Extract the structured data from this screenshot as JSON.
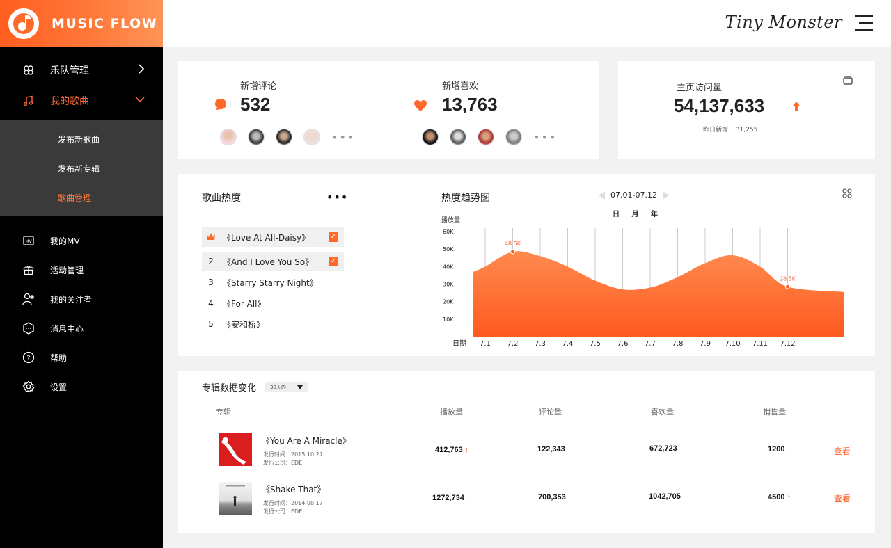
{
  "sidebar": {
    "brand": "MUSIC FLOW",
    "items": [
      {
        "label": "乐队管理",
        "icon": "band-icon"
      },
      {
        "label": "我的歌曲",
        "icon": "music-note-icon"
      }
    ],
    "subitems": [
      {
        "label": "发布新歌曲"
      },
      {
        "label": "发布新专辑"
      },
      {
        "label": "歌曲管理"
      }
    ],
    "lower_items": [
      {
        "label": "我的MV",
        "icon": "mv-icon"
      },
      {
        "label": "活动管理",
        "icon": "gift-icon"
      },
      {
        "label": "我的关注者",
        "icon": "user-add-icon"
      },
      {
        "label": "消息中心",
        "icon": "message-icon"
      },
      {
        "label": "帮助",
        "icon": "help-icon"
      },
      {
        "label": "设置",
        "icon": "gear-icon"
      }
    ]
  },
  "topbar": {
    "script_brand": "Tiny Monster"
  },
  "stats": {
    "comments": {
      "label": "新增评论",
      "value": "532"
    },
    "likes": {
      "label": "新增喜欢",
      "value": "13,763"
    },
    "visits": {
      "label": "主页访问量",
      "value": "54,137,633",
      "sub_label": "昨日新增",
      "sub_value": "31,255"
    }
  },
  "popularity": {
    "title": "歌曲热度",
    "songs": [
      {
        "rank": "",
        "title": "《Love At All-Daisy》"
      },
      {
        "rank": "2",
        "title": "《And I Love You So》"
      },
      {
        "rank": "3",
        "title": "《Starry Starry Night》"
      },
      {
        "rank": "4",
        "title": "《For All》"
      },
      {
        "rank": "5",
        "title": "《安和桥》"
      }
    ]
  },
  "trend": {
    "title": "热度趋势图",
    "range": "07.01-07.12",
    "periods": [
      "日",
      "月",
      "年"
    ]
  },
  "chart_data": {
    "type": "area",
    "ylabel": "播放量",
    "xlabel": "日期",
    "yticks": [
      "10K",
      "20K",
      "30K",
      "40K",
      "50K",
      "60K"
    ],
    "categories": [
      "7.1",
      "7.2",
      "7.3",
      "7.4",
      "7.5",
      "7.6",
      "7.7",
      "7.8",
      "7.9",
      "7.10",
      "7.11",
      "7.12"
    ],
    "values": [
      40,
      48.5,
      46,
      40,
      32,
      27,
      28,
      34,
      42,
      46.5,
      40,
      28.5
    ],
    "ylim": [
      0,
      62
    ],
    "annotations": [
      {
        "x": "7.2",
        "label": "48.5K"
      },
      {
        "x": "7.12",
        "label": "28.5K"
      }
    ],
    "color": "#ff6a2a"
  },
  "albums": {
    "title": "专辑数据变化",
    "filter": "30天内",
    "headers": [
      "专辑",
      "播放量",
      "评论量",
      "喜欢量",
      "销售量"
    ],
    "rows": [
      {
        "title": "《You Are A Miracle》",
        "date": "发行时间：2015.10.27",
        "company": "发行公司：EDEI",
        "plays": "412,763",
        "comments": "122,343",
        "likes": "672,723",
        "sales": "1200",
        "action": "查看"
      },
      {
        "title": "《Shake That》",
        "date": "发行时间：2014.08.17",
        "company": "发行公司：EDEI",
        "plays": "1272,734",
        "comments": "700,353",
        "likes": "1042,705",
        "sales": "4500",
        "action": "查看"
      }
    ]
  }
}
